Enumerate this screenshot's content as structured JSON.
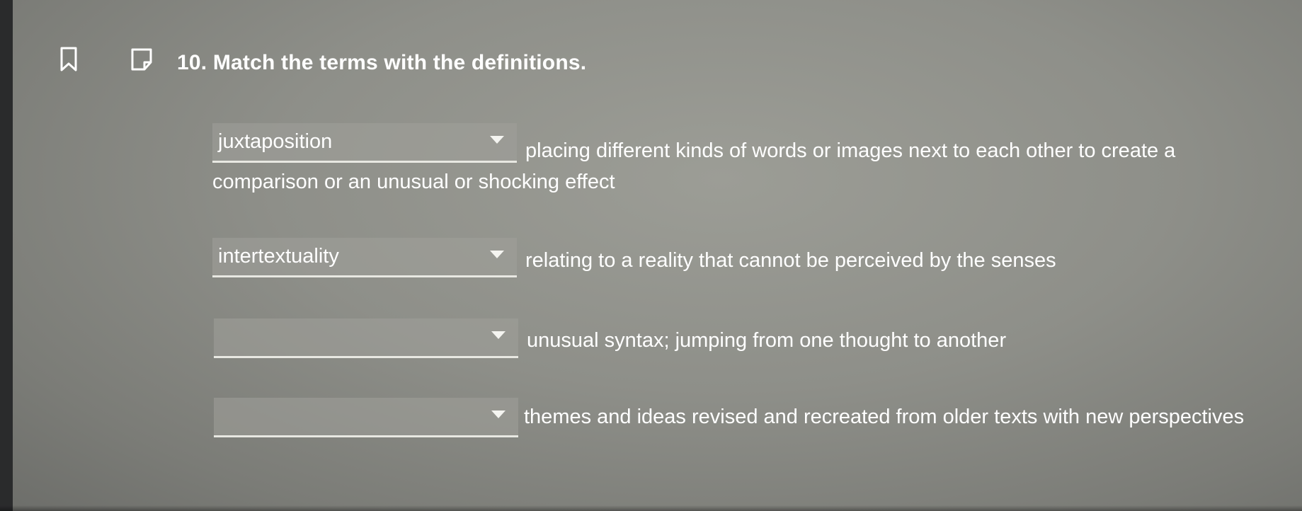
{
  "question": {
    "title": "10. Match the terms with the definitions."
  },
  "icons": {
    "bookmark": "bookmark-icon",
    "note": "note-icon"
  },
  "matches": [
    {
      "selected": "juxtaposition",
      "definition_line1": "placing different kinds of words or images next to each other to create a",
      "definition_line2": "comparison or an unusual or shocking effect"
    },
    {
      "selected": "intertextuality",
      "definition_line1": "relating to a reality that cannot be perceived by the senses"
    },
    {
      "selected": "",
      "definition_line1": "unusual syntax; jumping from one thought to another"
    },
    {
      "selected": "",
      "definition_line1": "themes and ideas revised and recreated from older texts with new perspectives"
    }
  ]
}
